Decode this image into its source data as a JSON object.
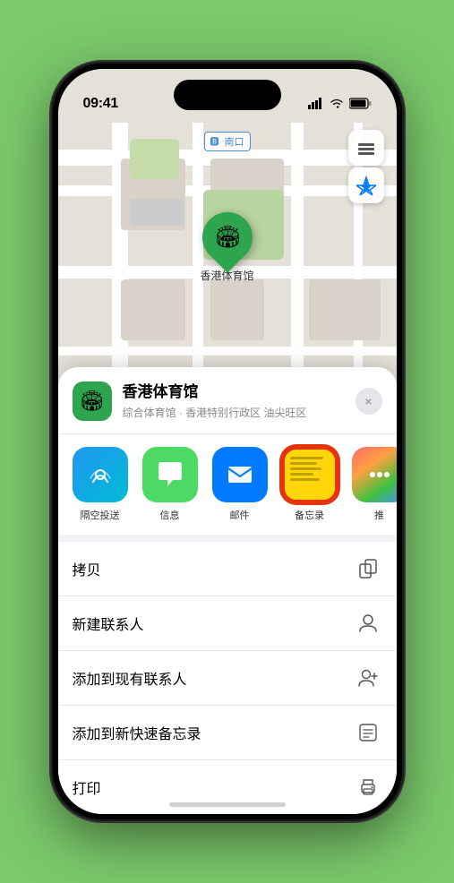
{
  "statusBar": {
    "time": "09:41",
    "locationIcon": "▶",
    "signalBars": "●●●●",
    "wifi": "wifi",
    "battery": "battery"
  },
  "map": {
    "label": "南口"
  },
  "pin": {
    "label": "香港体育馆",
    "icon": "🏟"
  },
  "locationCard": {
    "name": "香港体育馆",
    "subtitle": "综合体育馆 · 香港特别行政区 油尖旺区",
    "closeLabel": "×"
  },
  "shareRow": [
    {
      "id": "airdrop",
      "label": "隔空投送",
      "icon": "📡",
      "type": "airdrop"
    },
    {
      "id": "messages",
      "label": "信息",
      "icon": "💬",
      "type": "messages"
    },
    {
      "id": "mail",
      "label": "邮件",
      "icon": "✉️",
      "type": "mail"
    },
    {
      "id": "notes",
      "label": "备忘录",
      "icon": "notes",
      "type": "notes"
    },
    {
      "id": "more",
      "label": "推",
      "icon": "⋯",
      "type": "more-options"
    }
  ],
  "actions": [
    {
      "label": "拷贝",
      "icon": "copy"
    },
    {
      "label": "新建联系人",
      "icon": "person"
    },
    {
      "label": "添加到现有联系人",
      "icon": "person-add"
    },
    {
      "label": "添加到新快速备忘录",
      "icon": "note"
    },
    {
      "label": "打印",
      "icon": "print"
    }
  ]
}
